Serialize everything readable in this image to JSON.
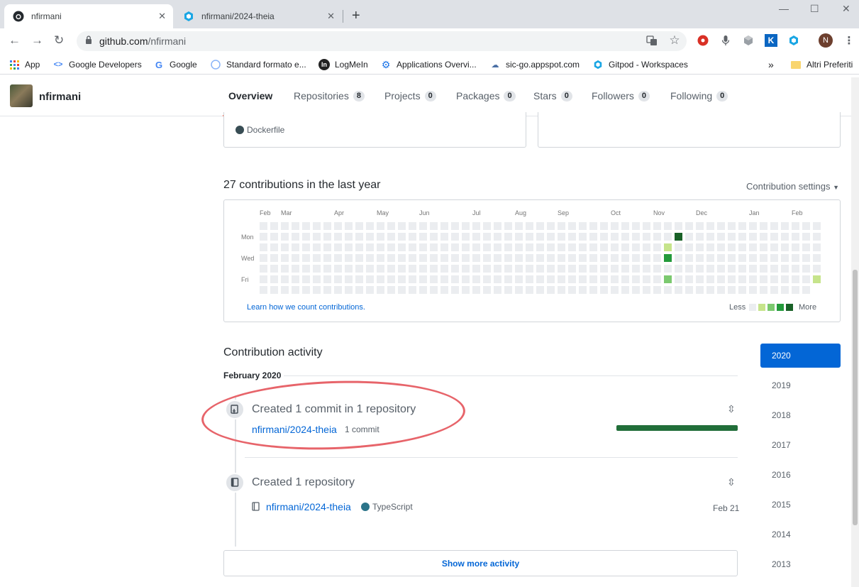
{
  "browser": {
    "tabs": [
      {
        "title": "nfirmani",
        "active": true,
        "icon": "github-icon"
      },
      {
        "title": "nfirmani/2024-theia",
        "active": false,
        "icon": "gitpod-icon"
      }
    ],
    "url_host": "github.com",
    "url_path": "/nfirmani",
    "profile_initial": "N",
    "bookmarks": [
      {
        "label": "App",
        "icon": "apps-grid-icon"
      },
      {
        "label": "Google Developers",
        "icon": "google-dev-icon"
      },
      {
        "label": "Google",
        "icon": "google-icon"
      },
      {
        "label": "Standard formato e...",
        "icon": "globe-icon"
      },
      {
        "label": "LogMeIn",
        "icon": "logmein-icon"
      },
      {
        "label": "Applications Overvi...",
        "icon": "settings-icon"
      },
      {
        "label": "sic-go.appspot.com",
        "icon": "cloud-icon"
      },
      {
        "label": "Gitpod - Workspaces",
        "icon": "gitpod-icon"
      },
      {
        "label": "Altri Preferiti",
        "icon": "folder-icon"
      }
    ],
    "bookmarks_overflow": "»"
  },
  "profile": {
    "username": "nfirmani",
    "nav": [
      {
        "label": "Overview",
        "count": null,
        "selected": true
      },
      {
        "label": "Repositories",
        "count": "8"
      },
      {
        "label": "Projects",
        "count": "0"
      },
      {
        "label": "Packages",
        "count": "0"
      },
      {
        "label": "Stars",
        "count": "0"
      },
      {
        "label": "Followers",
        "count": "0"
      },
      {
        "label": "Following",
        "count": "0"
      }
    ]
  },
  "pinned": {
    "left_lang": "Dockerfile",
    "left_lang_color": "#384d54"
  },
  "contributions": {
    "title": "27 contributions in the last year",
    "settings_label": "Contribution settings",
    "months": [
      "Feb",
      "Mar",
      "Apr",
      "May",
      "Jun",
      "Jul",
      "Aug",
      "Sep",
      "Oct",
      "Nov",
      "Dec",
      "Jan",
      "Feb"
    ],
    "days": [
      "Mon",
      "Wed",
      "Fri"
    ],
    "learn_link": "Learn how we count contributions.",
    "legend_less": "Less",
    "legend_more": "More",
    "colors": [
      "#ebedf0",
      "#c6e48b",
      "#7bc96f",
      "#239a3b",
      "#196127"
    ],
    "weeks": 53,
    "active_cells": [
      {
        "week": 38,
        "day": 2,
        "level": 1
      },
      {
        "week": 38,
        "day": 3,
        "level": 3
      },
      {
        "week": 38,
        "day": 5,
        "level": 2
      },
      {
        "week": 39,
        "day": 1,
        "level": 4
      },
      {
        "week": 52,
        "day": 5,
        "level": 1
      }
    ]
  },
  "activity": {
    "title": "Contribution activity",
    "month": "February 2020",
    "item1": {
      "title": "Created 1 commit in 1 repository",
      "repo": "nfirmani/2024-theia",
      "meta": "1 commit"
    },
    "item2": {
      "title": "Created 1 repository",
      "repo": "nfirmani/2024-theia",
      "lang": "TypeScript",
      "lang_color": "#2b7489",
      "date": "Feb 21"
    },
    "show_more": "Show more activity"
  },
  "years": [
    "2020",
    "2019",
    "2018",
    "2017",
    "2016",
    "2015",
    "2014",
    "2013"
  ]
}
